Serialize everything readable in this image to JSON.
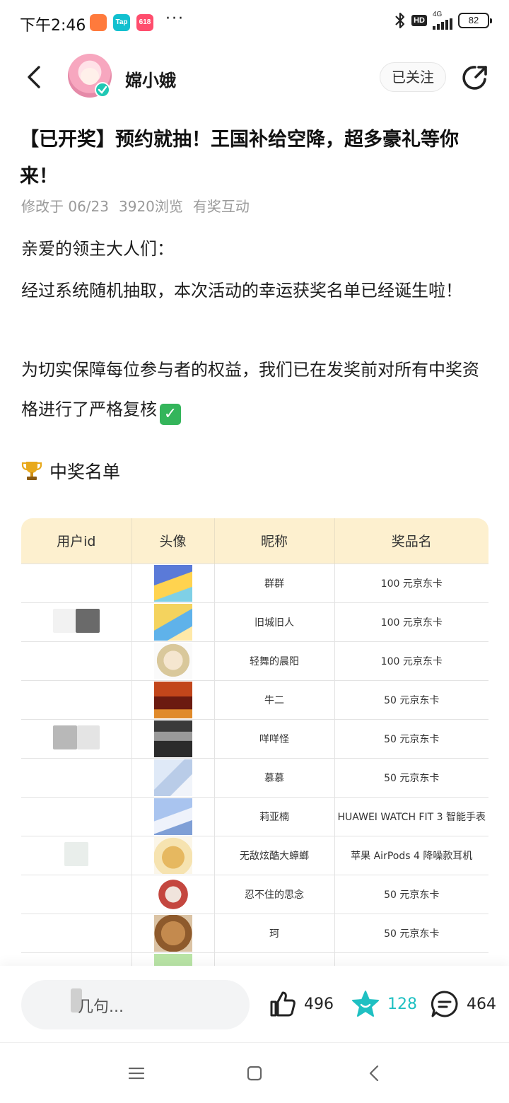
{
  "status_bar": {
    "time": "下午2:46",
    "app_icons": [
      "taobao-icon",
      "tap-icon",
      "game-618-icon"
    ],
    "dots": "···",
    "hd_badge": "HD",
    "network": "4G",
    "battery": "82"
  },
  "header": {
    "username": "嫦小娥",
    "follow_label": "已关注"
  },
  "post": {
    "title": "【已开奖】预约就抽！王国补给空降，超多豪礼等你来！",
    "meta": {
      "modified": "修改于 06/23",
      "views": "3920浏览",
      "tag": "有奖互动"
    },
    "greeting": "亲爱的领主大人们：",
    "para1": "经过系统随机抽取，本次活动的幸运获奖名单已经诞生啦！",
    "para2": "为切实保障每位参与者的权益，我们已在发奖前对所有中奖资格进行了严格复核",
    "winners_heading": "中奖名单"
  },
  "table": {
    "headers": [
      "用户id",
      "头像",
      "昵称",
      "奖品名"
    ],
    "rows": [
      {
        "nickname": "群群",
        "prize": "100 元京东卡"
      },
      {
        "nickname": "旧城旧人",
        "prize": "100 元京东卡"
      },
      {
        "nickname": "轻舞的晨阳",
        "prize": "100 元京东卡"
      },
      {
        "nickname": "牛二",
        "prize": "50 元京东卡"
      },
      {
        "nickname": "咩咩怪",
        "prize": "50 元京东卡"
      },
      {
        "nickname": "慕慕",
        "prize": "50 元京东卡"
      },
      {
        "nickname": "莉亚楠",
        "prize": "HUAWEI WATCH FIT 3 智能手表"
      },
      {
        "nickname": "无敌炫酷大蟑螂",
        "prize": "苹果 AirPods 4 降噪款耳机"
      },
      {
        "nickname": "忍不住的思念",
        "prize": "50 元京东卡"
      },
      {
        "nickname": "珂",
        "prize": "50 元京东卡"
      },
      {
        "nickname": "",
        "prize": ""
      }
    ]
  },
  "action_bar": {
    "comment_placeholder": "几句...",
    "likes": "496",
    "favorites": "128",
    "comments": "464"
  },
  "colors": {
    "accent": "#1fc0c2",
    "table_header": "#fdf0cf",
    "meta_text": "#9a9a9a"
  }
}
